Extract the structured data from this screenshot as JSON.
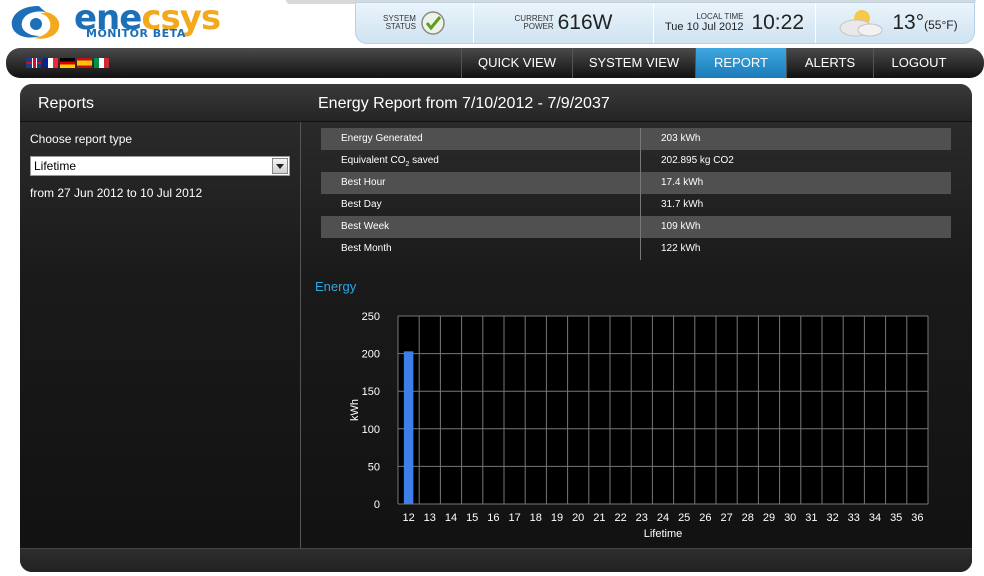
{
  "brand": {
    "name_part1": "ene",
    "name_part2": "csys",
    "sub_part1": "MONITOR",
    "sub_part2": "BETA"
  },
  "status": {
    "system_label_1": "SYSTEM",
    "system_label_2": "STATUS",
    "power_label_1": "CURRENT",
    "power_label_2": "POWER",
    "power_value": "616W",
    "time_label": "LOCAL TIME",
    "date": "Tue 10 Jul 2012",
    "time": "10:22",
    "temp": "13°",
    "temp_f": "(55°F)"
  },
  "nav": {
    "flags": [
      "uk-flag-icon",
      "fr-flag-icon",
      "de-flag-icon",
      "es-flag-icon",
      "it-flag-icon"
    ],
    "items": [
      {
        "label": "QUICK VIEW"
      },
      {
        "label": "SYSTEM VIEW"
      },
      {
        "label": "REPORT",
        "active": true
      },
      {
        "label": "ALERTS"
      },
      {
        "label": "LOGOUT"
      }
    ]
  },
  "reports": {
    "title": "Reports",
    "choose_label": "Choose report type",
    "selected_type": "Lifetime",
    "range_text": "from 27 Jun 2012 to 10 Jul 2012"
  },
  "report": {
    "title": "Energy Report from 7/10/2012 - 7/9/2037",
    "stats": [
      {
        "label": "Energy Generated",
        "value": "203 kWh"
      },
      {
        "label_pre": "Equivalent CO",
        "label_sub": "2",
        "label_post": " saved",
        "value": "202.895 kg CO2"
      },
      {
        "label": "Best Hour",
        "value": "17.4 kWh"
      },
      {
        "label": "Best Day",
        "value": "31.7 kWh"
      },
      {
        "label": "Best Week",
        "value": "109 kWh"
      },
      {
        "label": "Best Month",
        "value": "122 kWh"
      }
    ],
    "energy_title": "Energy"
  },
  "chart_data": {
    "type": "bar",
    "categories": [
      "12",
      "13",
      "14",
      "15",
      "16",
      "17",
      "18",
      "19",
      "20",
      "21",
      "22",
      "23",
      "24",
      "25",
      "26",
      "27",
      "28",
      "29",
      "30",
      "31",
      "32",
      "33",
      "34",
      "35",
      "36"
    ],
    "values": [
      203,
      0,
      0,
      0,
      0,
      0,
      0,
      0,
      0,
      0,
      0,
      0,
      0,
      0,
      0,
      0,
      0,
      0,
      0,
      0,
      0,
      0,
      0,
      0,
      0
    ],
    "xlabel": "Lifetime",
    "ylabel": "kWh",
    "ylim": [
      0,
      250
    ],
    "yticks": [
      0,
      50,
      100,
      150,
      200,
      250
    ],
    "grid": true,
    "bar_color": "#3d7fe6"
  },
  "colors": {
    "accent": "#2ea7e6",
    "nav_active": "#2a90cc",
    "status_bg": "#dbeaf5"
  }
}
